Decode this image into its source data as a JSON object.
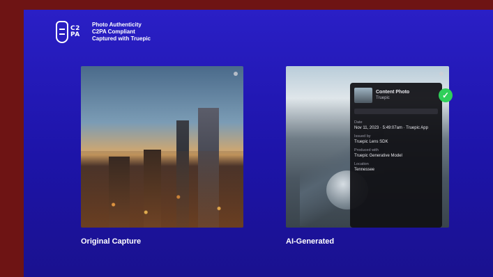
{
  "header": {
    "logo_text_1": "C2",
    "logo_text_2": "PA",
    "lines": [
      "Photo Authenticity",
      "C2PA Compliant",
      "Captured with Truepic"
    ]
  },
  "panels": {
    "left": {
      "caption": "Original Capture"
    },
    "right": {
      "caption": "AI-Generated",
      "info": {
        "title": "Content Photo",
        "subtitle": "Truepic",
        "sections": [
          {
            "label": "Date",
            "value": "Nov 11, 2023 · 5:49:07am · Truepic App"
          },
          {
            "label": "Issued by",
            "value": "Truepic Lens SDK"
          },
          {
            "label": "Produced with",
            "value": "Truepic Generative Model"
          },
          {
            "label": "Location",
            "value": "Tennessee"
          }
        ]
      }
    }
  },
  "colors": {
    "background": "#6e1414",
    "frame": "#2a1fc6",
    "badge": "#2fcf5a"
  }
}
